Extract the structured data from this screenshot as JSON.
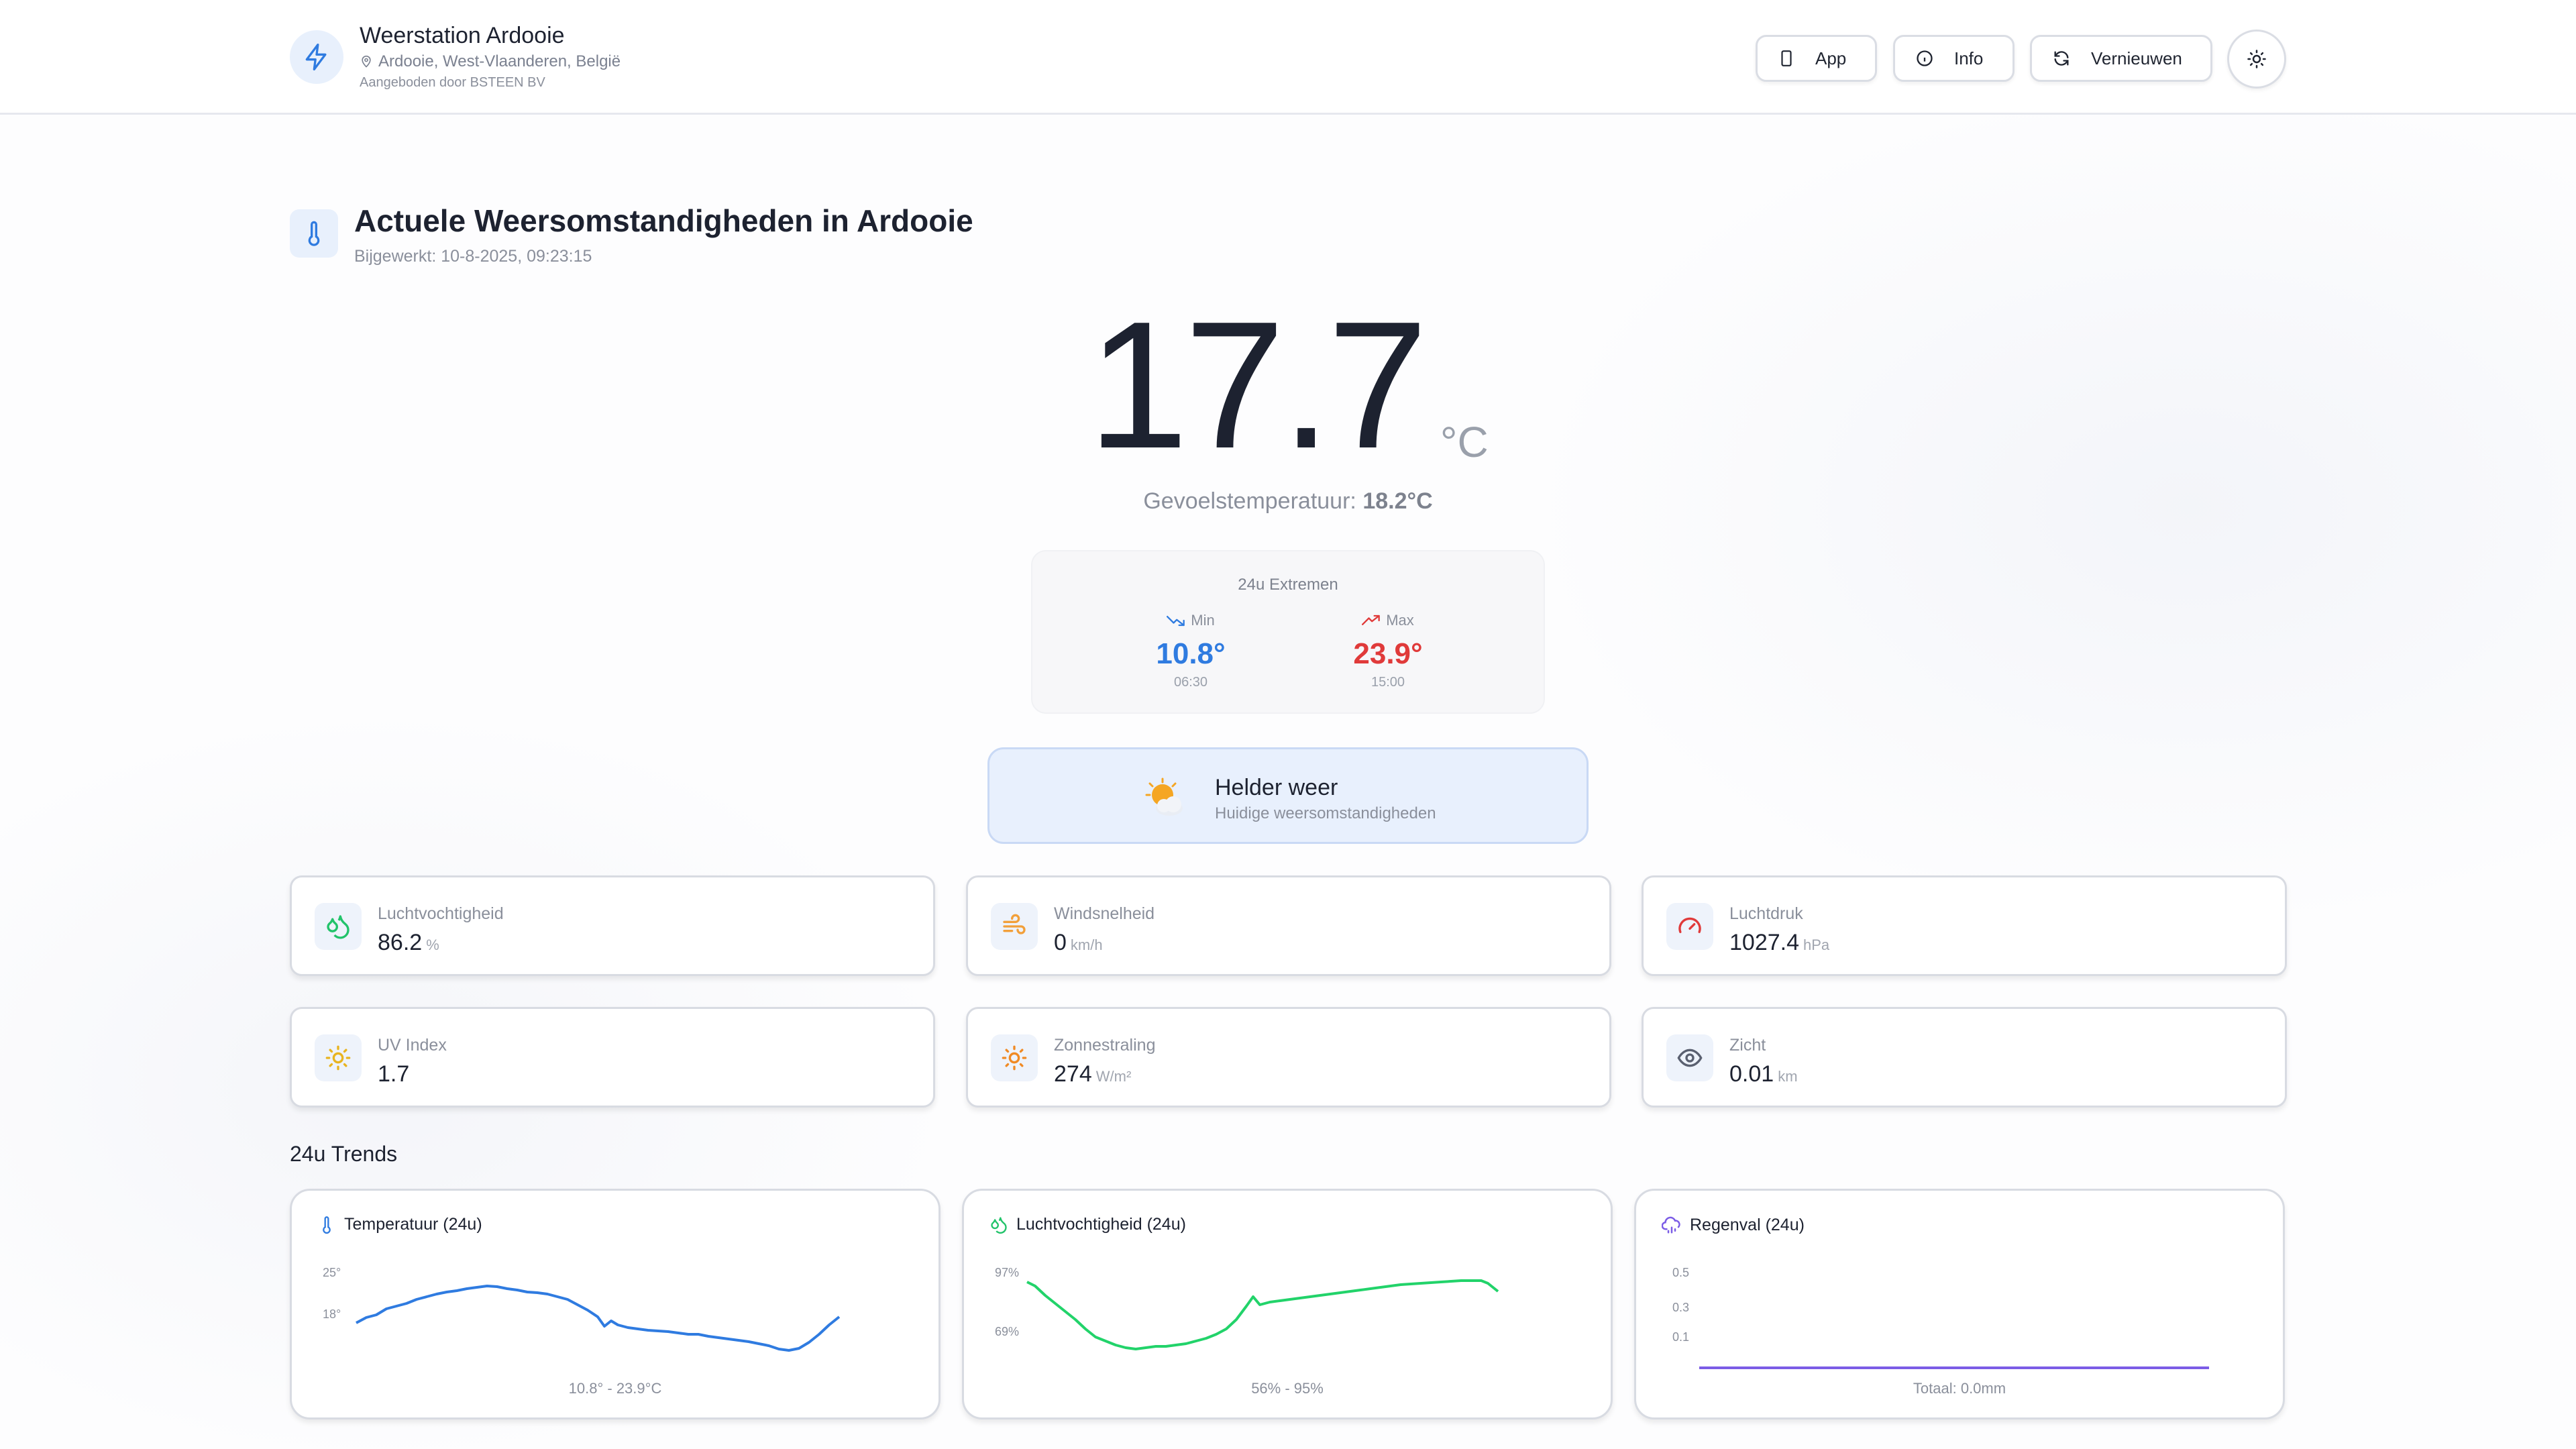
{
  "header": {
    "title": "Weerstation Ardooie",
    "location": "Ardooie, West-Vlaanderen, België",
    "provider": "Aangeboden door BSTEEN BV",
    "buttons": {
      "app": "App",
      "info": "Info",
      "refresh": "Vernieuwen"
    }
  },
  "current": {
    "heading": "Actuele Weersomstandigheden in Ardooie",
    "updated": "Bijgewerkt: 10-8-2025, 09:23:15",
    "temperature": "17.7",
    "unit": "°C",
    "feels_label": "Gevoelstemperatuur:",
    "feels_value": "18.2°C"
  },
  "extremes": {
    "title": "24u Extremen",
    "min_label": "Min",
    "min_value": "10.8°",
    "min_time": "06:30",
    "max_label": "Max",
    "max_value": "23.9°",
    "max_time": "15:00",
    "min_color": "#2f7be0",
    "max_color": "#e03a3a"
  },
  "condition": {
    "title": "Helder weer",
    "subtitle": "Huidige weersomstandigheden"
  },
  "metrics": [
    {
      "label": "Luchtvochtigheid",
      "value": "86.2",
      "unit": "%",
      "icon": "droplets-icon"
    },
    {
      "label": "Windsnelheid",
      "value": "0",
      "unit": "km/h",
      "icon": "wind-icon"
    },
    {
      "label": "Luchtdruk",
      "value": "1027.4",
      "unit": "hPa",
      "icon": "gauge-icon"
    },
    {
      "label": "UV Index",
      "value": "1.7",
      "unit": "",
      "icon": "sun-icon"
    },
    {
      "label": "Zonnestraling",
      "value": "274",
      "unit": "W/m²",
      "icon": "sun-icon"
    },
    {
      "label": "Zicht",
      "value": "0.01",
      "unit": "km",
      "icon": "eye-icon"
    }
  ],
  "trends": {
    "title": "24u Trends",
    "temperature": {
      "title": "Temperatuur (24u)",
      "footer": "10.8° - 23.9°C",
      "color": "#2f7be0",
      "y_ticks": [
        "25°",
        "18°"
      ]
    },
    "humidity": {
      "title": "Luchtvochtigheid (24u)",
      "footer": "56% - 95%",
      "color": "#22d36a",
      "y_ticks": [
        "97%",
        "69%"
      ]
    },
    "rain": {
      "title": "Regenval (24u)",
      "footer": "Totaal: 0.0mm",
      "color": "#7b5ce6",
      "y_ticks": [
        "0.5",
        "0.3",
        "0.1"
      ]
    }
  }
}
